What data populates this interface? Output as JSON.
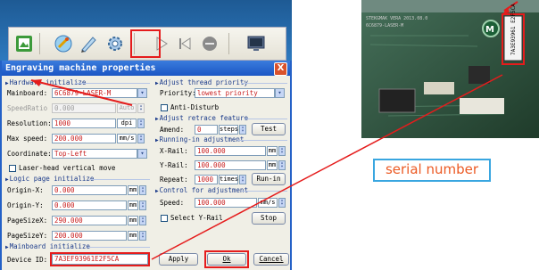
{
  "dialog": {
    "title": "Engraving machine properties",
    "close_label": "X",
    "hardware": {
      "section": "Hardware initialize",
      "mainboard_label": "Mainboard:",
      "mainboard_value": "6C6879-LASER-M",
      "speed_ratio_label": "SpeedRatio",
      "speed_ratio_value": "0.000",
      "speed_ratio_unit": "Auto",
      "resolution_label": "Resolution:",
      "resolution_value": "1000",
      "resolution_unit": "dpi",
      "max_speed_label": "Max speed:",
      "max_speed_value": "200.000",
      "max_speed_unit": "mm/s",
      "coordinate_label": "Coordinate:",
      "coordinate_value": "Top-Left",
      "laser_head_label": "Laser-head vertical move"
    },
    "logic_page": {
      "section": "Logic page initialize",
      "origin_x_label": "Origin-X:",
      "origin_x_value": "0.000",
      "origin_y_label": "Origin-Y:",
      "origin_y_value": "0.000",
      "page_size_x_label": "PageSizeX:",
      "page_size_x_value": "290.000",
      "page_size_y_label": "PageSizeY:",
      "page_size_y_value": "200.000",
      "unit": "mm"
    },
    "mainboard_init": {
      "section": "Mainboard initialize",
      "device_id_label": "Device ID:",
      "device_id_value": "7A3EF93961E2F5CA"
    },
    "thread": {
      "section": "Adjust thread priority",
      "priority_label": "Priority:",
      "priority_value": "lowest priority",
      "anti_disturb_label": "Anti-Disturb"
    },
    "retrace": {
      "section": "Adjust retrace feature",
      "amend_label": "Amend:",
      "amend_value": "0",
      "amend_unit": "steps",
      "test_label": "Test"
    },
    "running": {
      "section": "Running-in adjustment",
      "x_rail_label": "X-Rail:",
      "x_rail_value": "100.000",
      "y_rail_label": "Y-Rail:",
      "y_rail_value": "100.000",
      "rail_unit": "mm",
      "repeat_label": "Repeat:",
      "repeat_value": "1000",
      "repeat_unit": "times",
      "run_in_label": "Run-in"
    },
    "control": {
      "section": "Control for adjustment",
      "speed_label": "Speed:",
      "speed_value": "100.000",
      "speed_unit": "mm/s",
      "select_y_rail_label": "Select Y-Rail",
      "stop_label": "Stop"
    },
    "buttons": {
      "apply": "Apply",
      "ok": "Ok",
      "cancel": "Cancel"
    }
  },
  "callout": {
    "label": "serial number"
  },
  "photo_text": {
    "line1": "STEKGMAK VERA 2013.08.0",
    "line2": "6C6879-LASER-M",
    "sticker": "7A3E93961 E2F5CA"
  },
  "colors": {
    "annotation_red": "#e51c1c",
    "callout_blue": "#39a6e0",
    "callout_orange": "#ec5a24"
  }
}
